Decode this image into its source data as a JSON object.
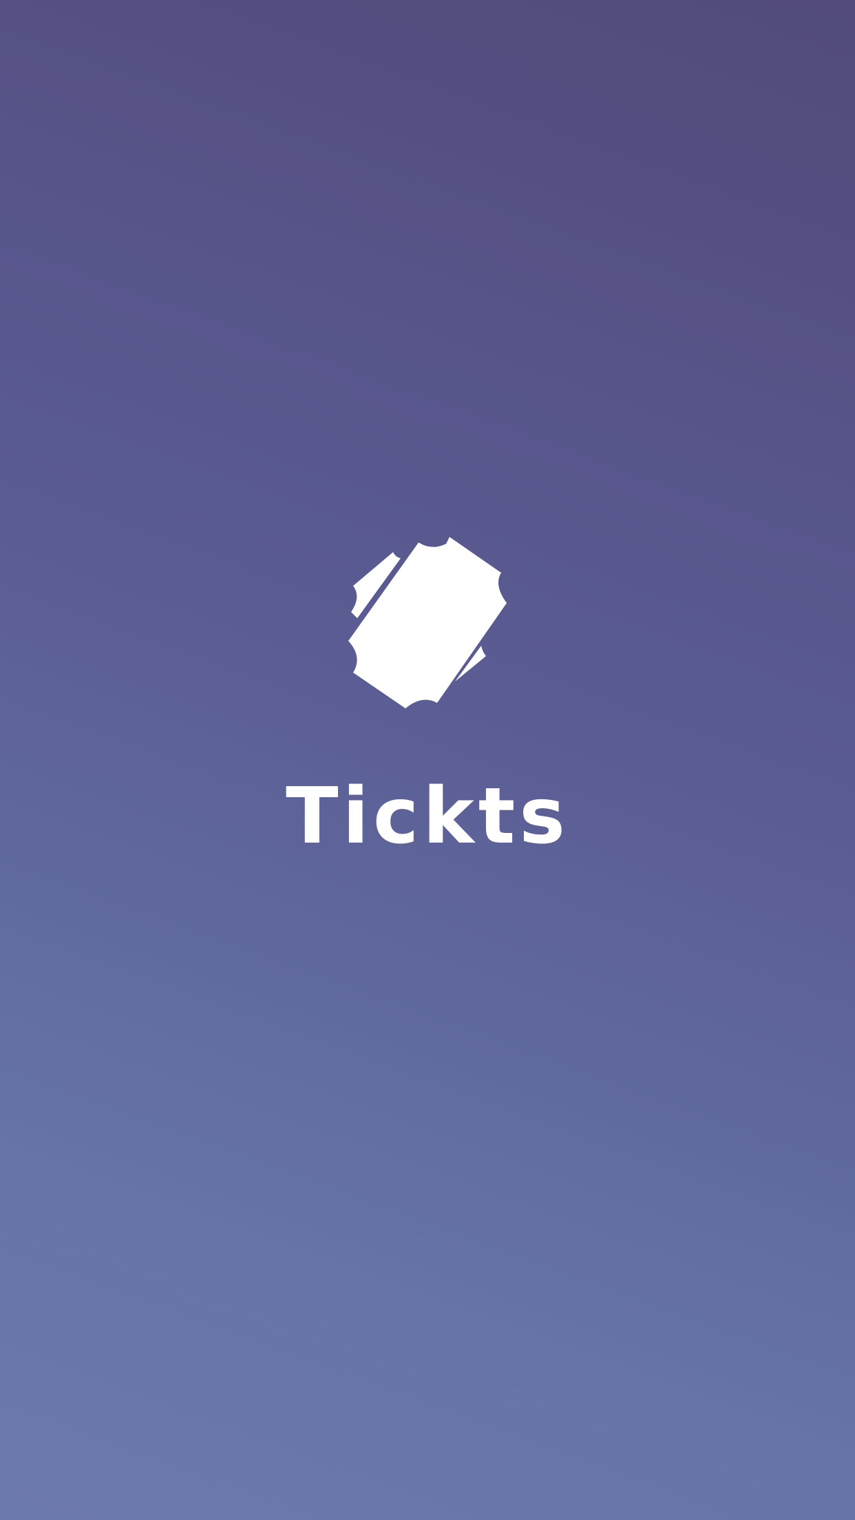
{
  "splash": {
    "app_name": "Tickts",
    "logo_icon": "ticket-icon",
    "colors": {
      "gradient_top": "#524a7c",
      "gradient_bottom": "#6c79ad",
      "foreground": "#ffffff"
    }
  }
}
